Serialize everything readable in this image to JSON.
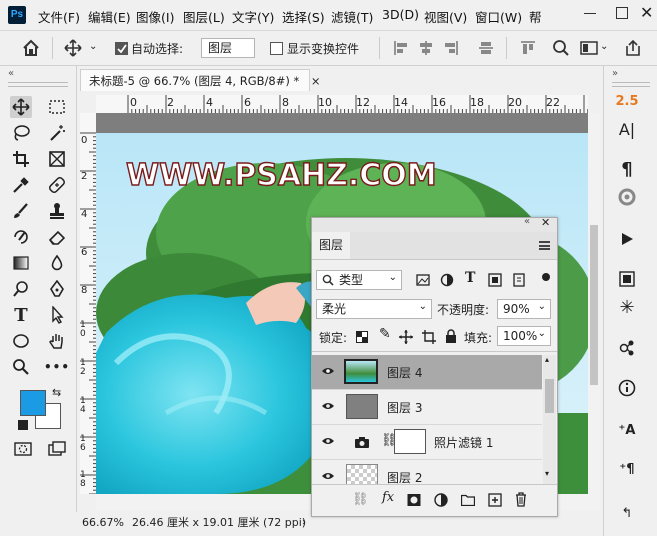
{
  "app": {
    "logo_text": "Ps"
  },
  "menubar": {
    "items": [
      "文件(F)",
      "编辑(E)",
      "图像(I)",
      "图层(L)",
      "文字(Y)",
      "选择(S)",
      "滤镜(T)",
      "3D(D)",
      "视图(V)",
      "窗口(W)",
      "帮"
    ]
  },
  "options": {
    "auto_select_label": "自动选择:",
    "auto_select_value": "图层",
    "show_transform_label": "显示变换控件"
  },
  "document": {
    "tab_title": "未标题-5 @ 66.7% (图层 4, RGB/8#) *",
    "close_icon": "×",
    "ruler_h_ticks": [
      "0",
      "2",
      "4",
      "6",
      "8",
      "10",
      "12",
      "14",
      "16",
      "18",
      "20",
      "22"
    ],
    "ruler_v_ticks": [
      "0",
      "2",
      "4",
      "6",
      "8",
      "10",
      "12",
      "14",
      "16",
      "18"
    ],
    "watermark": "WWW.PSAHZ.COM"
  },
  "status": {
    "zoom": "66.67%",
    "doc_size": "26.46 厘米 x 19.01 厘米 (72 ppi)"
  },
  "dock": {
    "value_25": "2.5"
  },
  "layers_panel": {
    "tab_label": "图层",
    "filter_label": "类型",
    "blend_mode": "柔光",
    "opacity_label": "不透明度:",
    "opacity_value": "90%",
    "lock_label": "锁定:",
    "fill_label": "填充:",
    "fill_value": "100%",
    "layers": [
      {
        "name": "图层 4",
        "selected": true
      },
      {
        "name": "图层 3",
        "selected": false
      },
      {
        "name": "照片滤镜 1",
        "selected": false
      },
      {
        "name": "图层 2",
        "selected": false
      }
    ]
  },
  "colors": {
    "foreground": "#1a9be3",
    "background": "#ffffff",
    "accent": "#e8791e"
  }
}
